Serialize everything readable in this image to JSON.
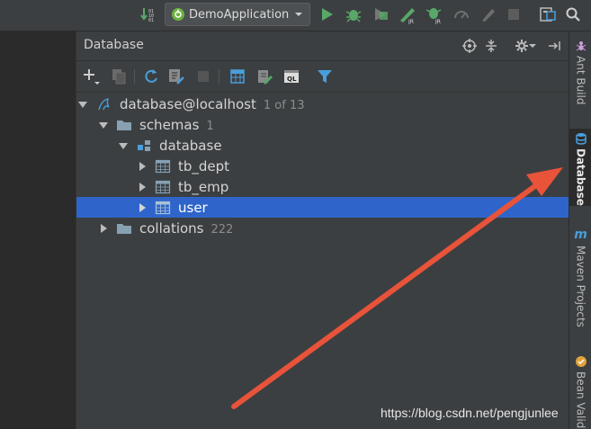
{
  "toolbar": {
    "run_config_label": "DemoApplication"
  },
  "panel": {
    "title": "Database"
  },
  "tree": [
    {
      "name": "database@localhost",
      "meta": "1 of 13",
      "icon": "datasource-icon"
    },
    {
      "name": "schemas",
      "meta": "1",
      "icon": "folder-icon"
    },
    {
      "name": "database",
      "meta": "",
      "icon": "schema-icon"
    },
    {
      "name": "tb_dept",
      "meta": "",
      "icon": "table-icon"
    },
    {
      "name": "tb_emp",
      "meta": "",
      "icon": "table-icon"
    },
    {
      "name": "user",
      "meta": "",
      "icon": "table-icon",
      "selected": true
    },
    {
      "name": "collations",
      "meta": "222",
      "icon": "folder-icon"
    }
  ],
  "sidebar": {
    "tabs": [
      "Ant Build",
      "Database",
      "Maven Projects",
      "Bean Valid"
    ]
  },
  "watermark": "https://blog.csdn.net/pengjunlee",
  "colors": {
    "selection": "#2f65ca",
    "annotation_arrow": "#e8533a",
    "run_green": "#59a869"
  }
}
